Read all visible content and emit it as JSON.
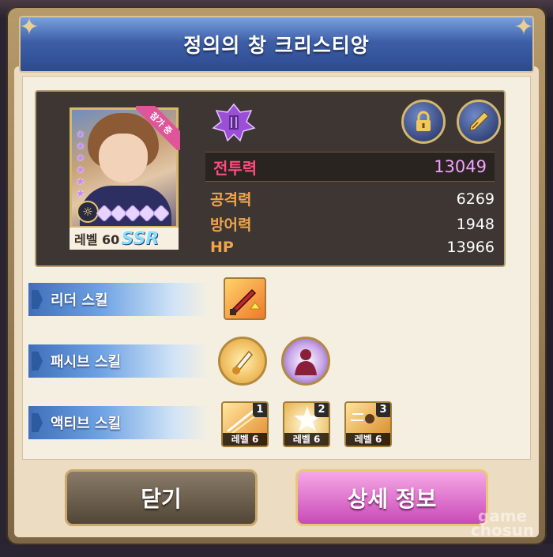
{
  "dialog": {
    "title": "정의의 창 크리스티앙"
  },
  "card": {
    "join_badge": "참가 중",
    "level_label": "레벨 60",
    "rarity": "SSR",
    "star_count": 6,
    "gem_count": 5
  },
  "stats": {
    "power_label": "전투력",
    "power_value": "13049",
    "attack_label": "공격력",
    "attack_value": "6269",
    "defense_label": "방어력",
    "defense_value": "1948",
    "hp_label": "HP",
    "hp_value": "13966"
  },
  "skills": {
    "leader_label": "리더 스킬",
    "passive_label": "패시브 스킬",
    "active_label": "액티브 스킬",
    "active": [
      {
        "num": "1",
        "level": "레벨 6"
      },
      {
        "num": "2",
        "level": "레벨 6"
      },
      {
        "num": "3",
        "level": "레벨 6"
      }
    ]
  },
  "buttons": {
    "close": "닫기",
    "detail": "상세 정보"
  },
  "icons": {
    "lock": "lock-icon",
    "pen": "pen-icon",
    "emblem": "class-emblem-icon"
  },
  "colors": {
    "header_blue": "#3d5fa7",
    "power_label": "#ff4b7f",
    "power_value": "#f2a0ff",
    "stat_label": "#f0a54a",
    "detail_button": "#c94ab7"
  },
  "watermark": "game chosun"
}
